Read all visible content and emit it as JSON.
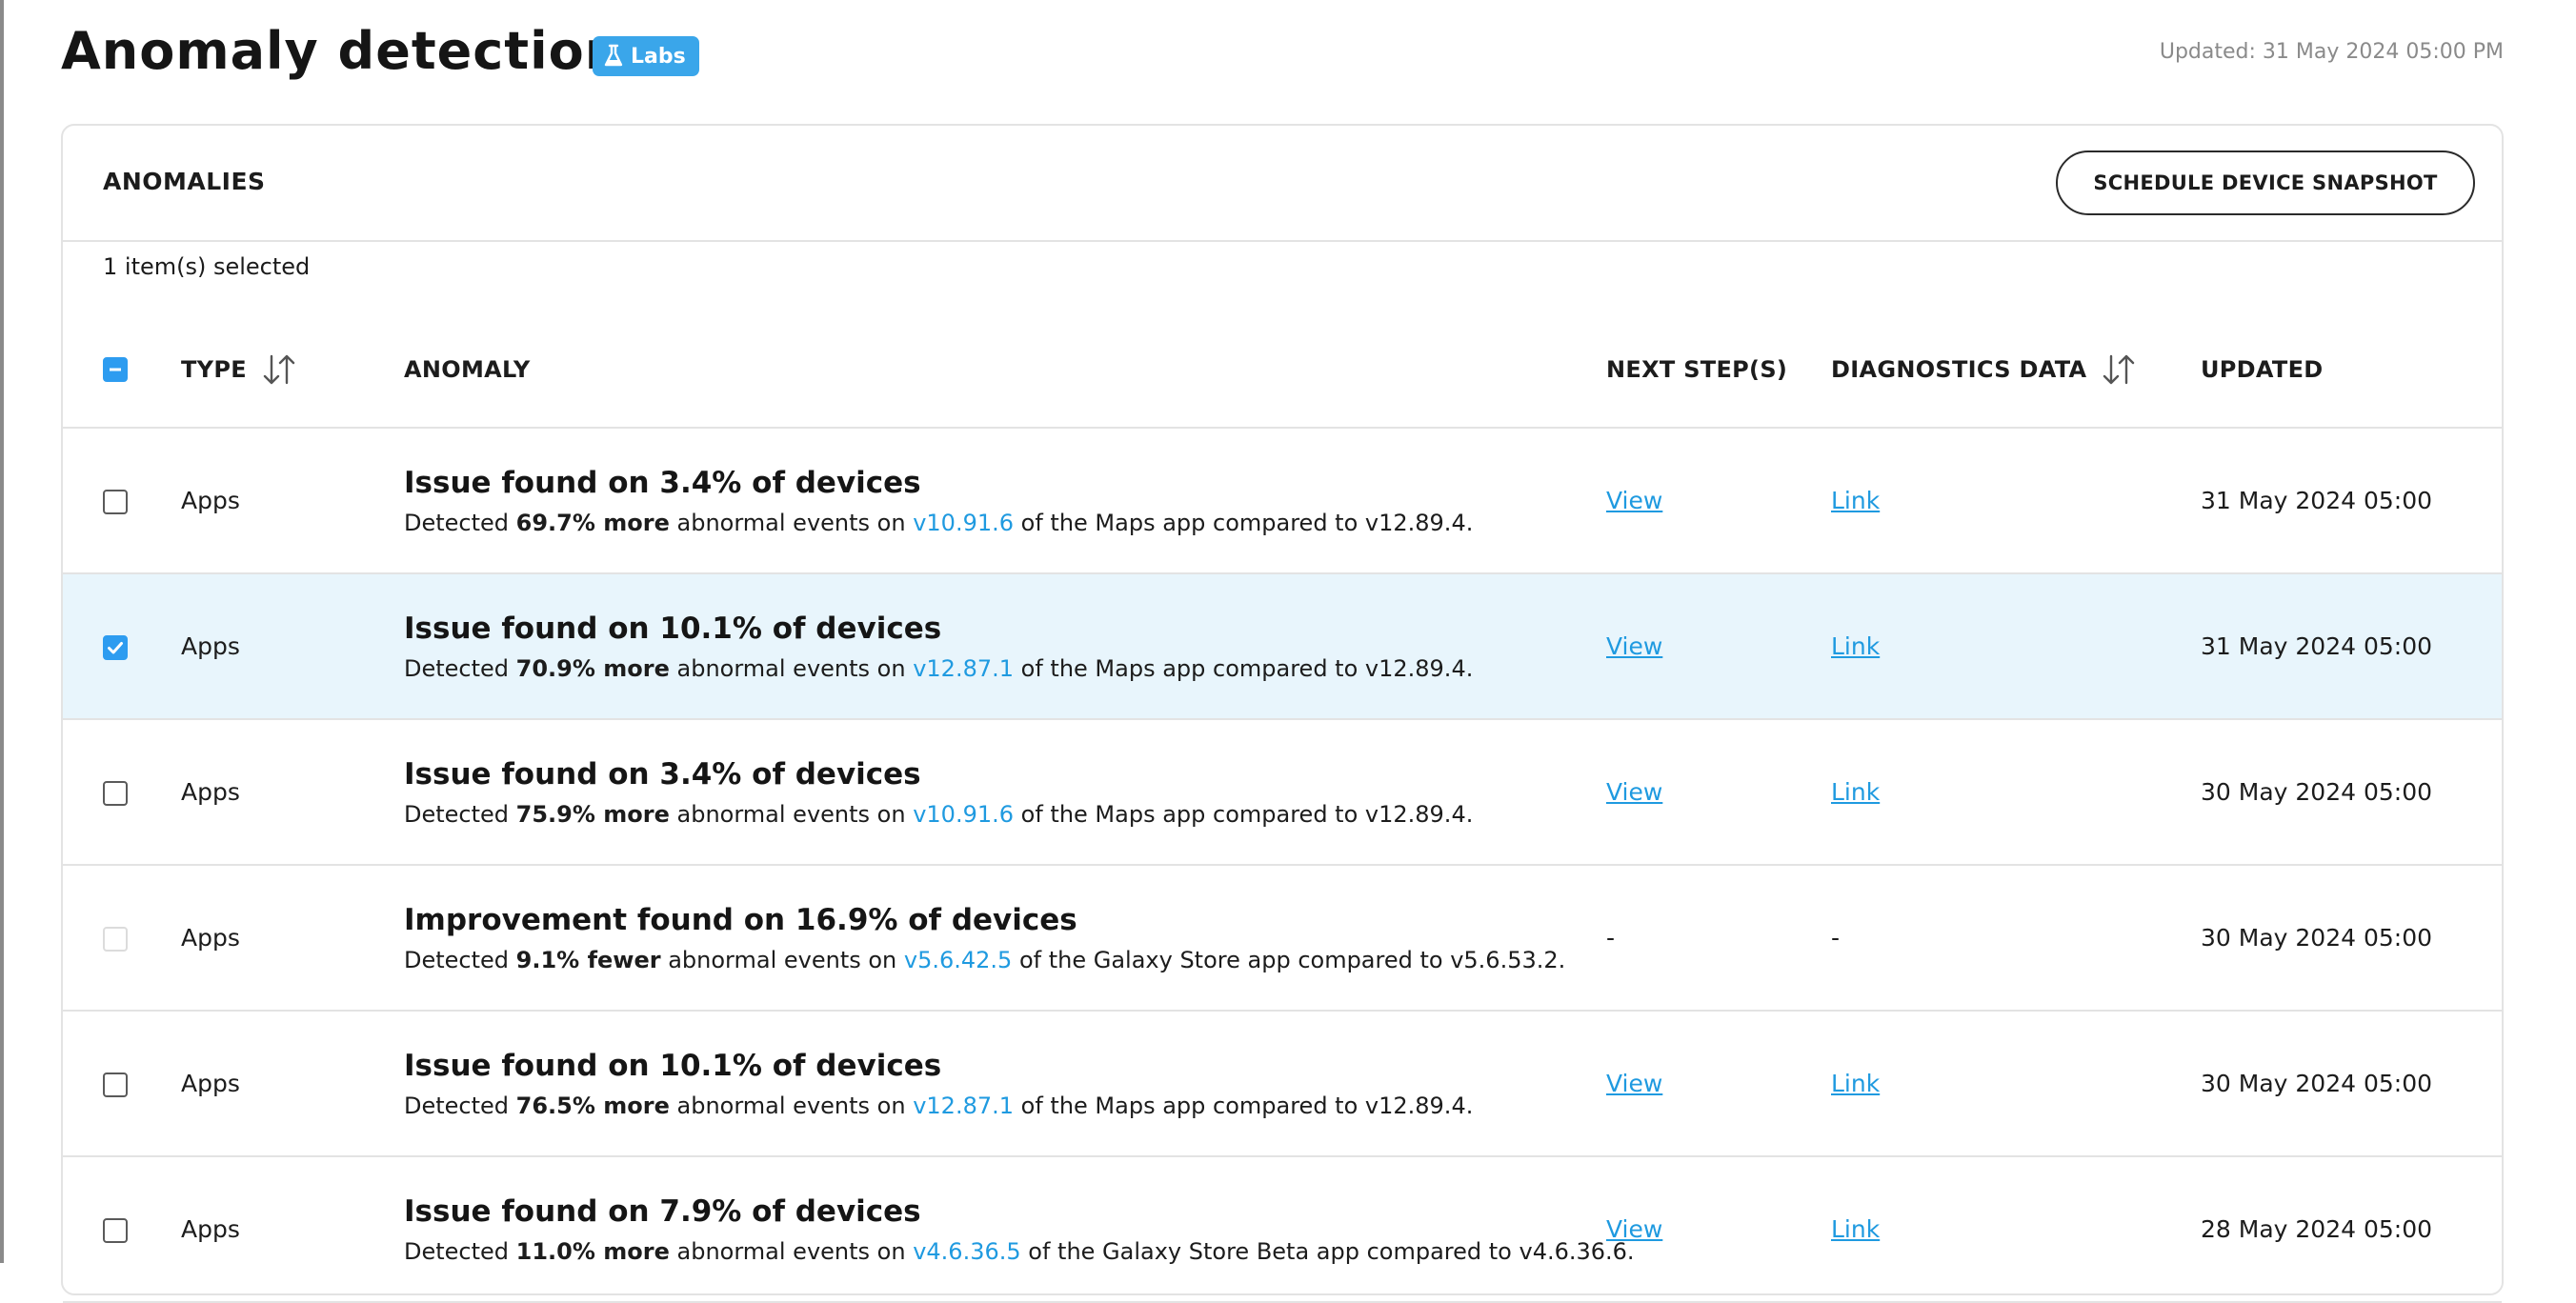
{
  "page": {
    "title": "Anomaly detection",
    "badge": "Labs",
    "updated": "Updated: 31 May 2024 05:00 PM"
  },
  "section": {
    "title": "ANOMALIES",
    "snapshot_button": "SCHEDULE DEVICE SNAPSHOT",
    "selected_count": "1 item(s) selected"
  },
  "columns": {
    "type": "TYPE",
    "anomaly": "ANOMALY",
    "next_steps": "NEXT STEP(S)",
    "diagnostics": "DIAGNOSTICS DATA",
    "updated": "UPDATED"
  },
  "colors": {
    "accent": "#2d9cf0",
    "link": "#1f9ae0",
    "selected_row": "#e8f5fc"
  },
  "rows": [
    {
      "checkbox": "unchecked",
      "type": "Apps",
      "title": "Issue found on 3.4% of devices",
      "detected": "Detected ",
      "amount": "69.7% more",
      "events": " abnormal events on ",
      "version": "v10.91.6",
      "app": " of the Maps app compared to v12.89.4.",
      "next_step": "View",
      "diagnostics": "Link",
      "updated": "31 May 2024 05:00"
    },
    {
      "checkbox": "checked",
      "type": "Apps",
      "title": "Issue found on 10.1% of devices",
      "detected": "Detected ",
      "amount": "70.9% more",
      "events": " abnormal events on ",
      "version": "v12.87.1",
      "app": " of the Maps app compared to v12.89.4.",
      "next_step": "View",
      "diagnostics": "Link",
      "updated": "31 May 2024 05:00"
    },
    {
      "checkbox": "unchecked",
      "type": "Apps",
      "title": "Issue found on 3.4% of devices",
      "detected": "Detected ",
      "amount": "75.9% more",
      "events": " abnormal events on ",
      "version": "v10.91.6",
      "app": " of the Maps app compared to v12.89.4.",
      "next_step": "View",
      "diagnostics": "Link",
      "updated": "30 May 2024 05:00"
    },
    {
      "checkbox": "disabled",
      "type": "Apps",
      "title": "Improvement found on 16.9% of devices",
      "detected": "Detected ",
      "amount": "9.1% fewer",
      "events": " abnormal events on ",
      "version": "v5.6.42.5",
      "app": " of the Galaxy Store app compared to v5.6.53.2.",
      "next_step": "-",
      "diagnostics": "-",
      "updated": "30 May 2024 05:00"
    },
    {
      "checkbox": "unchecked",
      "type": "Apps",
      "title": "Issue found on 10.1% of devices",
      "detected": "Detected ",
      "amount": "76.5% more",
      "events": " abnormal events on ",
      "version": "v12.87.1",
      "app": " of the Maps app compared to v12.89.4.",
      "next_step": "View",
      "diagnostics": "Link",
      "updated": "30 May 2024 05:00"
    },
    {
      "checkbox": "unchecked",
      "type": "Apps",
      "title": "Issue found on 7.9% of devices",
      "detected": "Detected ",
      "amount": "11.0% more",
      "events": " abnormal events on ",
      "version": "v4.6.36.5",
      "app": " of the Galaxy Store Beta app compared to v4.6.36.6.",
      "next_step": "View",
      "diagnostics": "Link",
      "updated": "28 May 2024 05:00"
    }
  ]
}
